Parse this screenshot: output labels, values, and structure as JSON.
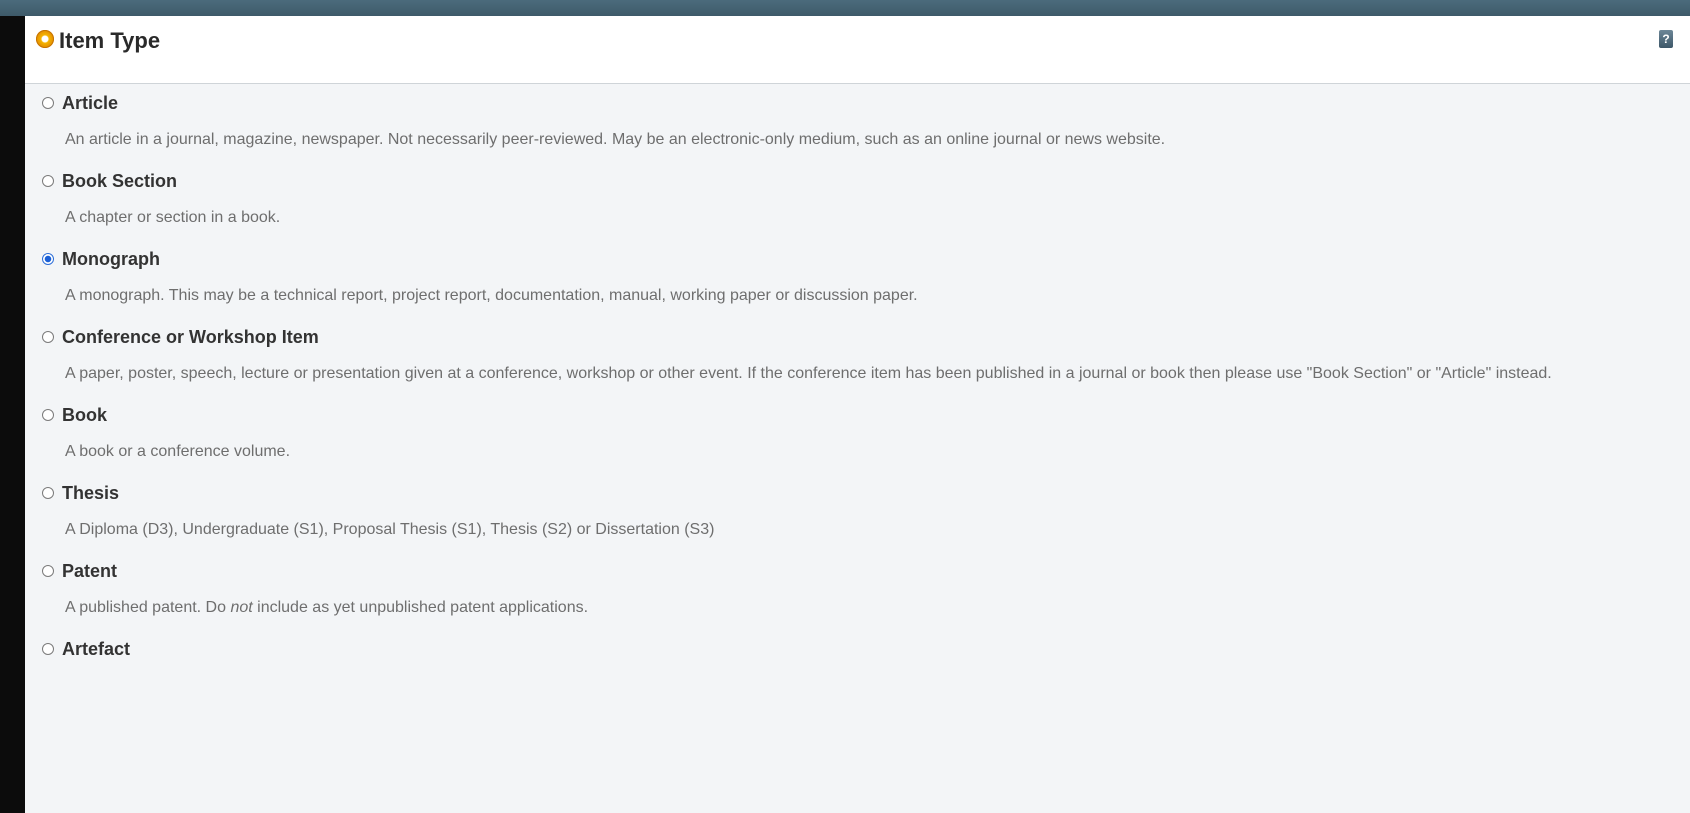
{
  "panel": {
    "title": "Item Type",
    "help_label": "?"
  },
  "options": [
    {
      "label": "Article",
      "selected": false,
      "description": "An article in a journal, magazine, newspaper. Not necessarily peer-reviewed. May be an electronic-only medium, such as an online journal or news website."
    },
    {
      "label": "Book Section",
      "selected": false,
      "description": "A chapter or section in a book."
    },
    {
      "label": "Monograph",
      "selected": true,
      "description": "A monograph. This may be a technical report, project report, documentation, manual, working paper or discussion paper."
    },
    {
      "label": "Conference or Workshop Item",
      "selected": false,
      "description": "A paper, poster, speech, lecture or presentation given at a conference, workshop or other event. If the conference item has been published in a journal or book then please use \"Book Section\" or \"Article\" instead."
    },
    {
      "label": "Book",
      "selected": false,
      "description": "A book or a conference volume."
    },
    {
      "label": "Thesis",
      "selected": false,
      "description": "A Diploma (D3), Undergraduate (S1), Proposal Thesis (S1), Thesis (S2) or Dissertation (S3)"
    },
    {
      "label": "Patent",
      "selected": false,
      "description_before": "A published patent. Do ",
      "description_emph": "not",
      "description_after": " include as yet unpublished patent applications."
    },
    {
      "label": "Artefact",
      "selected": false
    }
  ]
}
